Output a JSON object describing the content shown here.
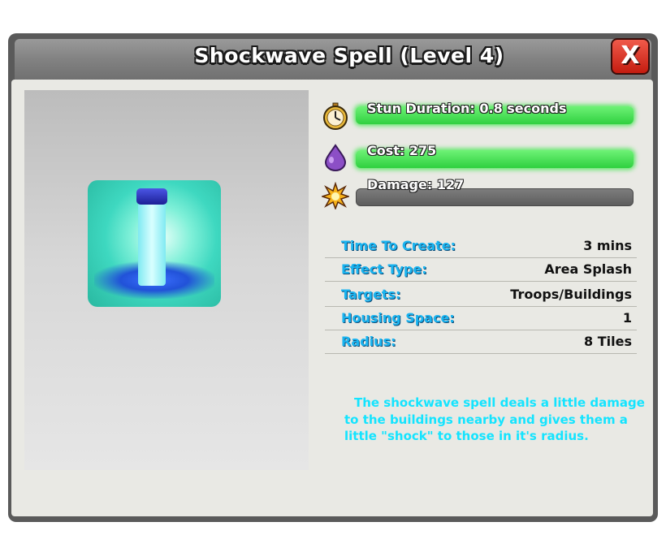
{
  "window": {
    "title": "Shockwave Spell (Level 4)",
    "close_label": "X"
  },
  "stats": [
    {
      "label": "Stun Duration: 0.8 seconds",
      "icon": "stopwatch-icon",
      "bar_fill": 1.0,
      "bar_color": "#3ee14e"
    },
    {
      "label": "Cost: 275",
      "icon": "elixir-drop-icon",
      "bar_fill": 1.0,
      "bar_color": "#3ee14e"
    },
    {
      "label": "Damage: 127",
      "icon": "explosion-icon",
      "bar_fill": 0.0,
      "bar_color": "#6d6d6d"
    }
  ],
  "details": [
    {
      "label": "Time To Create:",
      "value": "3 mins"
    },
    {
      "label": "Effect Type:",
      "value": "Area Splash"
    },
    {
      "label": "Targets:",
      "value": "Troops/Buildings"
    },
    {
      "label": "Housing Space:",
      "value": "1"
    },
    {
      "label": "Radius:",
      "value": "8 Tiles"
    }
  ],
  "description": "The shockwave spell deals a little damage to the buildings nearby and gives them a little \"shock\" to those in it's radius.",
  "colors": {
    "label_blue": "#1ab4f0",
    "description_cyan": "#14e4ff",
    "close_red": "#d6291c",
    "panel_bg": "#e9e9e4",
    "frame_dark": "#5a5a5a"
  }
}
